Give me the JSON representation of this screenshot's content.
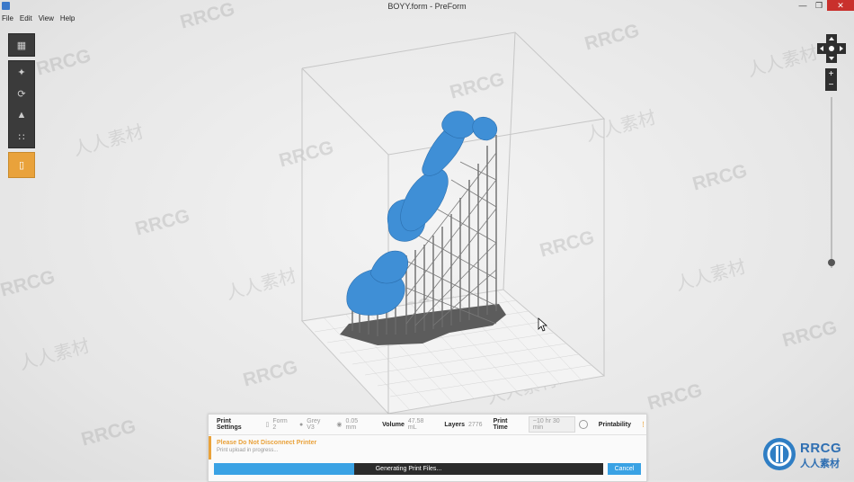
{
  "window": {
    "title": "BOYY.form - PreForm",
    "controls": [
      "minimize-icon",
      "restore-icon",
      "close-icon"
    ]
  },
  "menu": [
    "File",
    "Edit",
    "View",
    "Help"
  ],
  "toolbar_icons": [
    "layout-icon",
    "magic-wand-icon",
    "orient-icon",
    "supports-icon",
    "layout-grid-icon",
    "printer-icon"
  ],
  "print_settings": {
    "label": "Print Settings",
    "printer": "Form 2",
    "material": "Grey V3",
    "layer_height": "0.05 mm",
    "volume_label": "Volume",
    "volume_value": "47.58 mL",
    "layers_label": "Layers",
    "layers_value": "2776",
    "print_time_label": "Print Time",
    "print_time_value": "~10 hr 30 min",
    "printability_label": "Printability"
  },
  "warning": {
    "title": "Please Do Not Disconnect Printer",
    "subtitle": "Print upload in progress..."
  },
  "progress": {
    "label": "Generating Print Files...",
    "percent": 36
  },
  "cancel_label": "Cancel",
  "watermarks": {
    "latin": "RRCG",
    "cjk": "人人素材"
  },
  "logo": {
    "title": "RRCG",
    "subtitle": "人人素材"
  },
  "colors": {
    "model": "#3f8fd6",
    "supports": "#6b6b6b",
    "accent": "#e9a23b",
    "progress": "#3aa2e4"
  },
  "view_controls": {
    "zoom_in": "+",
    "zoom_out": "−",
    "zoom_level": 0.97
  }
}
